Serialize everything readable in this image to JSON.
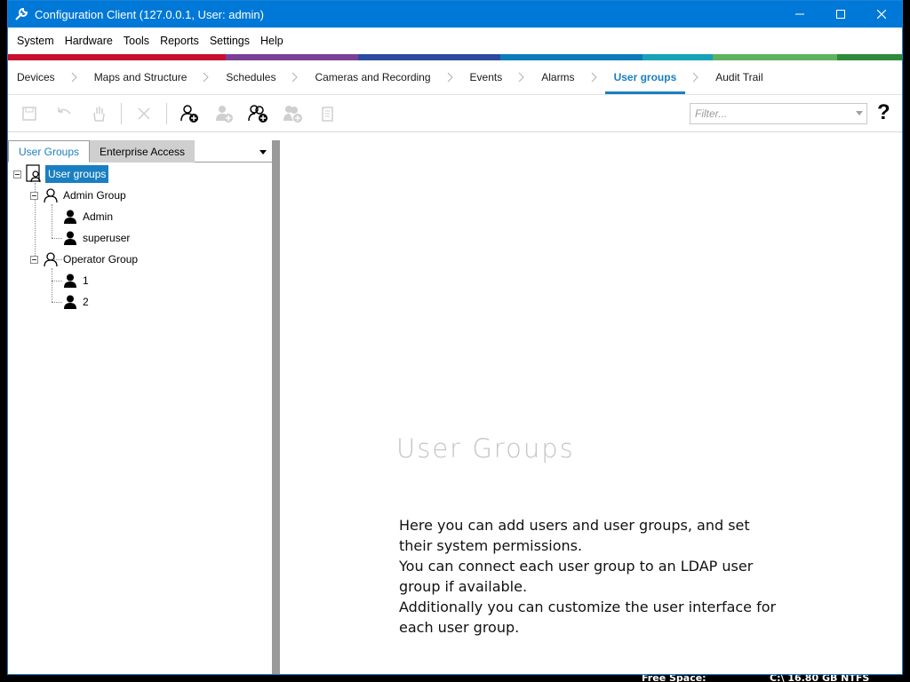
{
  "window": {
    "title": "Configuration Client (127.0.0.1, User: admin)"
  },
  "menu": [
    "System",
    "Hardware",
    "Tools",
    "Reports",
    "Settings",
    "Help"
  ],
  "stripe_colors": [
    "#c8102e",
    "#7b3f98",
    "#2b4aa0",
    "#0a7cbb",
    "#18a2b8",
    "#5fb35f",
    "#2e8b3a"
  ],
  "workflow": {
    "items": [
      "Devices",
      "Maps and Structure",
      "Schedules",
      "Cameras and Recording",
      "Events",
      "Alarms",
      "User groups",
      "Audit Trail"
    ],
    "active": "User groups"
  },
  "toolbar": {
    "filter_placeholder": "Filter...",
    "help_label": "?"
  },
  "left_tabs": {
    "tab1": "User Groups",
    "tab2": "Enterprise Access"
  },
  "tree": {
    "root": "User groups",
    "admin_group": "Admin Group",
    "admin_user": "Admin",
    "superuser": "superuser",
    "operator_group": "Operator Group",
    "user1": "1",
    "user2": "2"
  },
  "content": {
    "heading": "User Groups",
    "line1": "Here you can add users and user groups, and set their system permissions.",
    "line2": "You can connect each user group to an LDAP user group if available.",
    "line3": "Additionally you can customize the user interface for each user group."
  },
  "desktop": {
    "free_space_label": "Free Space:",
    "free_space_value": "C:\\ 16.80 GB NTFS"
  }
}
